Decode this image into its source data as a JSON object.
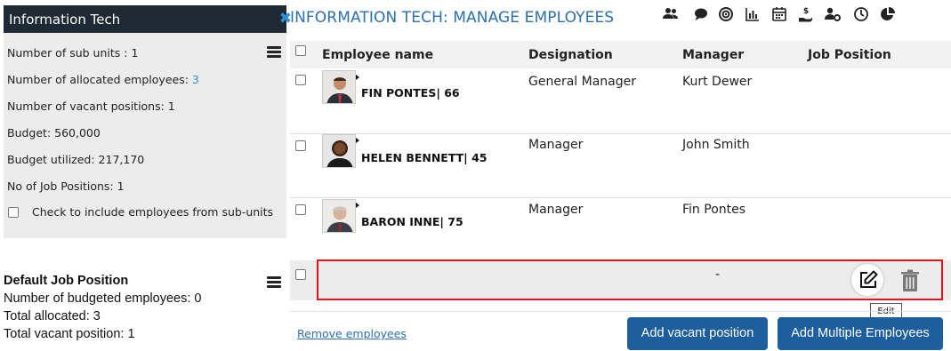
{
  "left_panel": {
    "title": "Information Tech",
    "stats": {
      "sub_units": "Number of sub units : 1",
      "allocated_label": "Number of allocated employees: ",
      "allocated_value": "3",
      "vacant": "Number of vacant positions: 1",
      "budget": "Budget: 560,000",
      "budget_utilized": "Budget utilized: 217,170",
      "job_positions": "No of Job Positions: 1"
    },
    "include_sub_units_label": "Check to include employees from sub-units"
  },
  "default_job": {
    "title": "Default Job Position",
    "budgeted": "Number of budgeted employees: 0",
    "allocated": "Total allocated: 3",
    "vacant": "Total vacant position: 1"
  },
  "page_title": "INFORMATION TECH: MANAGE EMPLOYEES",
  "toolbar": {
    "icons": [
      "people-icon",
      "chat-icon",
      "target-icon",
      "bar-chart-icon",
      "calendar-icon",
      "payment-icon",
      "user-settings-icon",
      "clock-icon",
      "pie-chart-icon"
    ]
  },
  "table": {
    "columns": {
      "name": "Employee name",
      "designation": "Designation",
      "manager": "Manager",
      "job_position": "Job Position"
    },
    "rows": [
      {
        "name": "FIN PONTES| 66",
        "designation": "General Manager",
        "manager": "Kurt Dewer",
        "job_position": ""
      },
      {
        "name": "HELEN BENNETT| 45",
        "designation": "Manager",
        "manager": "John Smith",
        "job_position": ""
      },
      {
        "name": "BARON INNE| 75",
        "designation": "Manager",
        "manager": "Fin Pontes",
        "job_position": ""
      }
    ],
    "vacant_row": {
      "value": "-"
    }
  },
  "tooltip": "Edit",
  "footer": {
    "remove_link": "Remove employees",
    "add_vacant": "Add vacant position",
    "add_multiple": "Add Multiple Employees"
  },
  "colors": {
    "header_dark": "#1e2a33",
    "accent_blue": "#2e6fae",
    "button_blue": "#1d5e9e",
    "highlight_red": "#e1141c"
  }
}
